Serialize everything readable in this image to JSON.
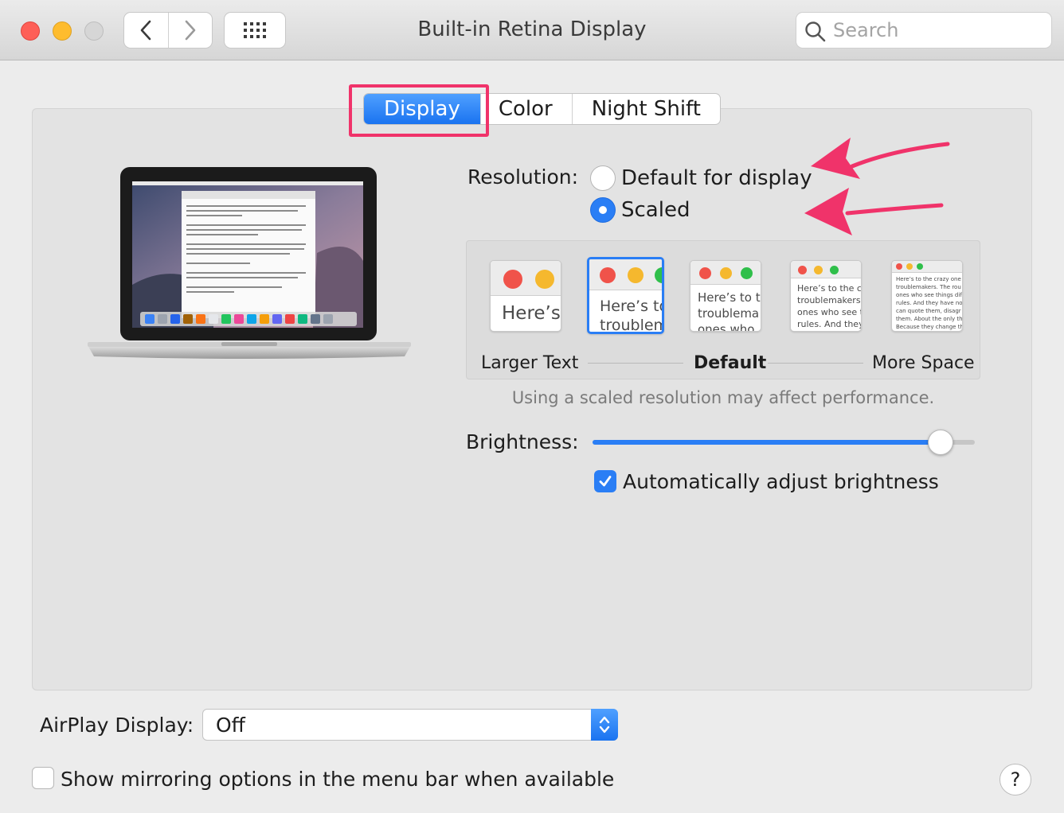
{
  "window": {
    "title": "Built-in Retina Display"
  },
  "search": {
    "placeholder": "Search"
  },
  "tabs": [
    {
      "label": "Display",
      "active": true
    },
    {
      "label": "Color",
      "active": false
    },
    {
      "label": "Night Shift",
      "active": false
    }
  ],
  "resolution": {
    "label": "Resolution:",
    "options": [
      {
        "label": "Default for display",
        "selected": false
      },
      {
        "label": "Scaled",
        "selected": true
      }
    ]
  },
  "scaled_options": {
    "thumbnails": [
      {
        "text": "Here’s",
        "selected": false
      },
      {
        "text": "Here’s to\ntroublem",
        "selected": true
      },
      {
        "text": "Here’s to t\ntroublema\nones who",
        "selected": false
      },
      {
        "text": "Here’s to the cr\ntroublemakers.\nones who see t\nrules. And they",
        "selected": false
      },
      {
        "text": "Here’s to the crazy one\ntroublemakers. The rou\nones who see things dif\nrules. And they have no\ncan quote them, disagr\nthem. About the only th\nBecause they change th",
        "selected": false
      }
    ],
    "left_label": "Larger Text",
    "center_label": "Default",
    "right_label": "More Space"
  },
  "performance_note": "Using a scaled resolution may affect performance.",
  "brightness": {
    "label": "Brightness:",
    "value": 0.91
  },
  "auto_brightness": {
    "label": "Automatically adjust brightness",
    "checked": true
  },
  "airplay": {
    "label": "AirPlay Display:",
    "value": "Off"
  },
  "mirroring": {
    "label": "Show mirroring options in the menu bar when available",
    "checked": false
  },
  "help": {
    "label": "?"
  },
  "colors": {
    "accent": "#2a7ef5",
    "annotation": "#f0336a"
  }
}
